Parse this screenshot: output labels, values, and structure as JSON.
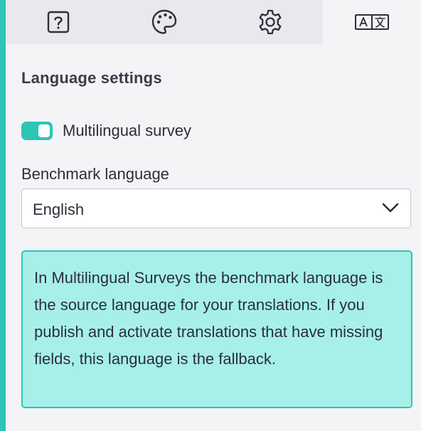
{
  "tabs": [
    {
      "id": "help",
      "icon": "help-icon",
      "active": false
    },
    {
      "id": "theme",
      "icon": "palette-icon",
      "active": false
    },
    {
      "id": "settings",
      "icon": "gear-icon",
      "active": false
    },
    {
      "id": "translation",
      "icon": "translate-icon",
      "active": true
    }
  ],
  "language_settings": {
    "title": "Language settings",
    "multilingual_toggle": {
      "label": "Multilingual survey",
      "enabled": true
    },
    "benchmark_language": {
      "label": "Benchmark language",
      "selected": "English"
    },
    "info_message": "In Multilingual Surveys the benchmark language is the source language for your translations. If you publish and activate translations that have missing fields, this language is the fallback."
  },
  "colors": {
    "accent": "#2ec4b6",
    "info_background": "#a7f0ea",
    "panel_background": "#f4f4f7",
    "inactive_tab": "#e8e8ed"
  }
}
